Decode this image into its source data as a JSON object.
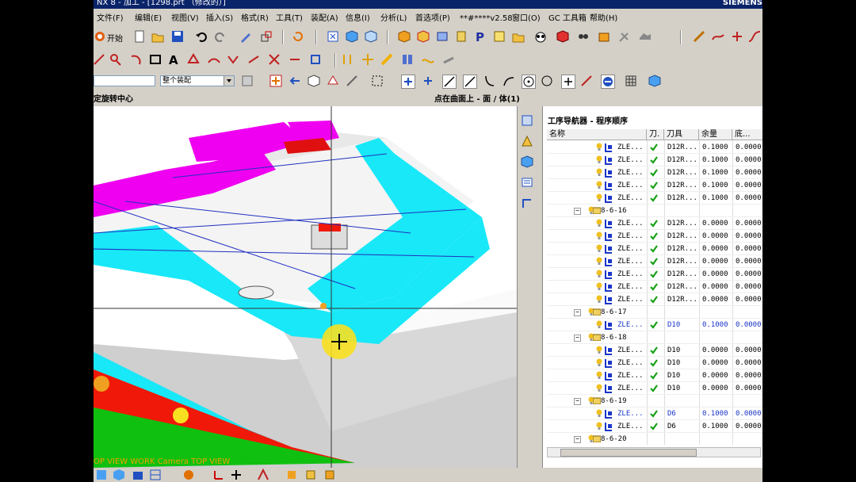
{
  "window": {
    "title": "NX 8 - 加工 - [1298.prt （修改的）]",
    "brand": "SIEMENS"
  },
  "menu": [
    "文件(F)",
    "编辑(E)",
    "视图(V)",
    "插入(S)",
    "格式(R)",
    "工具(T)",
    "装配(A)",
    "信息(I)",
    "分析(L)",
    "首选项(P)",
    "**#****v2.58",
    "窗口(O)",
    "GC 工具箱",
    "帮助(H)"
  ],
  "toolbar1": {
    "start_label": "开始"
  },
  "toolbar3": {
    "filter_value": "",
    "assembly_value": "整个装配"
  },
  "status": {
    "left": "定旋转中心",
    "center": "点在曲面上 - 面 / 体(1)"
  },
  "viewport": {
    "overlay": "OP VIEW WORK Camera TOP VIEW"
  },
  "navigator": {
    "title": "工序导航器 - 程序顺序",
    "columns": [
      "名称",
      "刀.",
      "刀具",
      "余量",
      "底..."
    ],
    "rows": [
      {
        "kind": "op",
        "name": "ZLE...",
        "tool": "D12R...",
        "stock": "0.1000",
        "floor": "0.0000",
        "blue": false
      },
      {
        "kind": "op",
        "name": "ZLE...",
        "tool": "D12R...",
        "stock": "0.1000",
        "floor": "0.0000",
        "blue": false
      },
      {
        "kind": "op",
        "name": "ZLE...",
        "tool": "D12R...",
        "stock": "0.1000",
        "floor": "0.0000",
        "blue": false
      },
      {
        "kind": "op",
        "name": "ZLE...",
        "tool": "D12R...",
        "stock": "0.1000",
        "floor": "0.0000",
        "blue": false
      },
      {
        "kind": "op",
        "name": "ZLE...",
        "tool": "D12R...",
        "stock": "0.1000",
        "floor": "0.0000",
        "blue": false
      },
      {
        "kind": "group",
        "name": "8-6-16"
      },
      {
        "kind": "op",
        "name": "ZLE...",
        "tool": "D12R...",
        "stock": "0.0000",
        "floor": "0.0000",
        "blue": false
      },
      {
        "kind": "op",
        "name": "ZLE...",
        "tool": "D12R...",
        "stock": "0.0000",
        "floor": "0.0000",
        "blue": false
      },
      {
        "kind": "op",
        "name": "ZLE...",
        "tool": "D12R...",
        "stock": "0.0000",
        "floor": "0.0000",
        "blue": false
      },
      {
        "kind": "op",
        "name": "ZLE...",
        "tool": "D12R...",
        "stock": "0.0000",
        "floor": "0.0000",
        "blue": false
      },
      {
        "kind": "op",
        "name": "ZLE...",
        "tool": "D12R...",
        "stock": "0.0000",
        "floor": "0.0000",
        "blue": false
      },
      {
        "kind": "op",
        "name": "ZLE...",
        "tool": "D12R...",
        "stock": "0.0000",
        "floor": "0.0000",
        "blue": false
      },
      {
        "kind": "op",
        "name": "ZLE...",
        "tool": "D12R...",
        "stock": "0.0000",
        "floor": "0.0000",
        "blue": false
      },
      {
        "kind": "group",
        "name": "8-6-17"
      },
      {
        "kind": "op",
        "name": "ZLE...",
        "tool": "D10",
        "stock": "0.1000",
        "floor": "0.0000",
        "blue": true
      },
      {
        "kind": "group",
        "name": "8-6-18"
      },
      {
        "kind": "op",
        "name": "ZLE...",
        "tool": "D10",
        "stock": "0.0000",
        "floor": "0.0000",
        "blue": false
      },
      {
        "kind": "op",
        "name": "ZLE...",
        "tool": "D10",
        "stock": "0.0000",
        "floor": "0.0000",
        "blue": false
      },
      {
        "kind": "op",
        "name": "ZLE...",
        "tool": "D10",
        "stock": "0.0000",
        "floor": "0.0000",
        "blue": false
      },
      {
        "kind": "op",
        "name": "ZLE...",
        "tool": "D10",
        "stock": "0.0000",
        "floor": "0.0000",
        "blue": false
      },
      {
        "kind": "group",
        "name": "8-6-19"
      },
      {
        "kind": "op",
        "name": "ZLE...",
        "tool": "D6",
        "stock": "0.1000",
        "floor": "0.0000",
        "blue": true
      },
      {
        "kind": "op",
        "name": "ZLE...",
        "tool": "D6",
        "stock": "0.1000",
        "floor": "0.0000",
        "blue": false
      },
      {
        "kind": "group",
        "name": "8-6-20"
      }
    ]
  },
  "colors": {
    "cyan": "#18e8f8",
    "magenta": "#f000f0",
    "red": "#f01808",
    "green": "#10c010",
    "check": "#18a018",
    "accent_blue": "#1a35c8"
  }
}
